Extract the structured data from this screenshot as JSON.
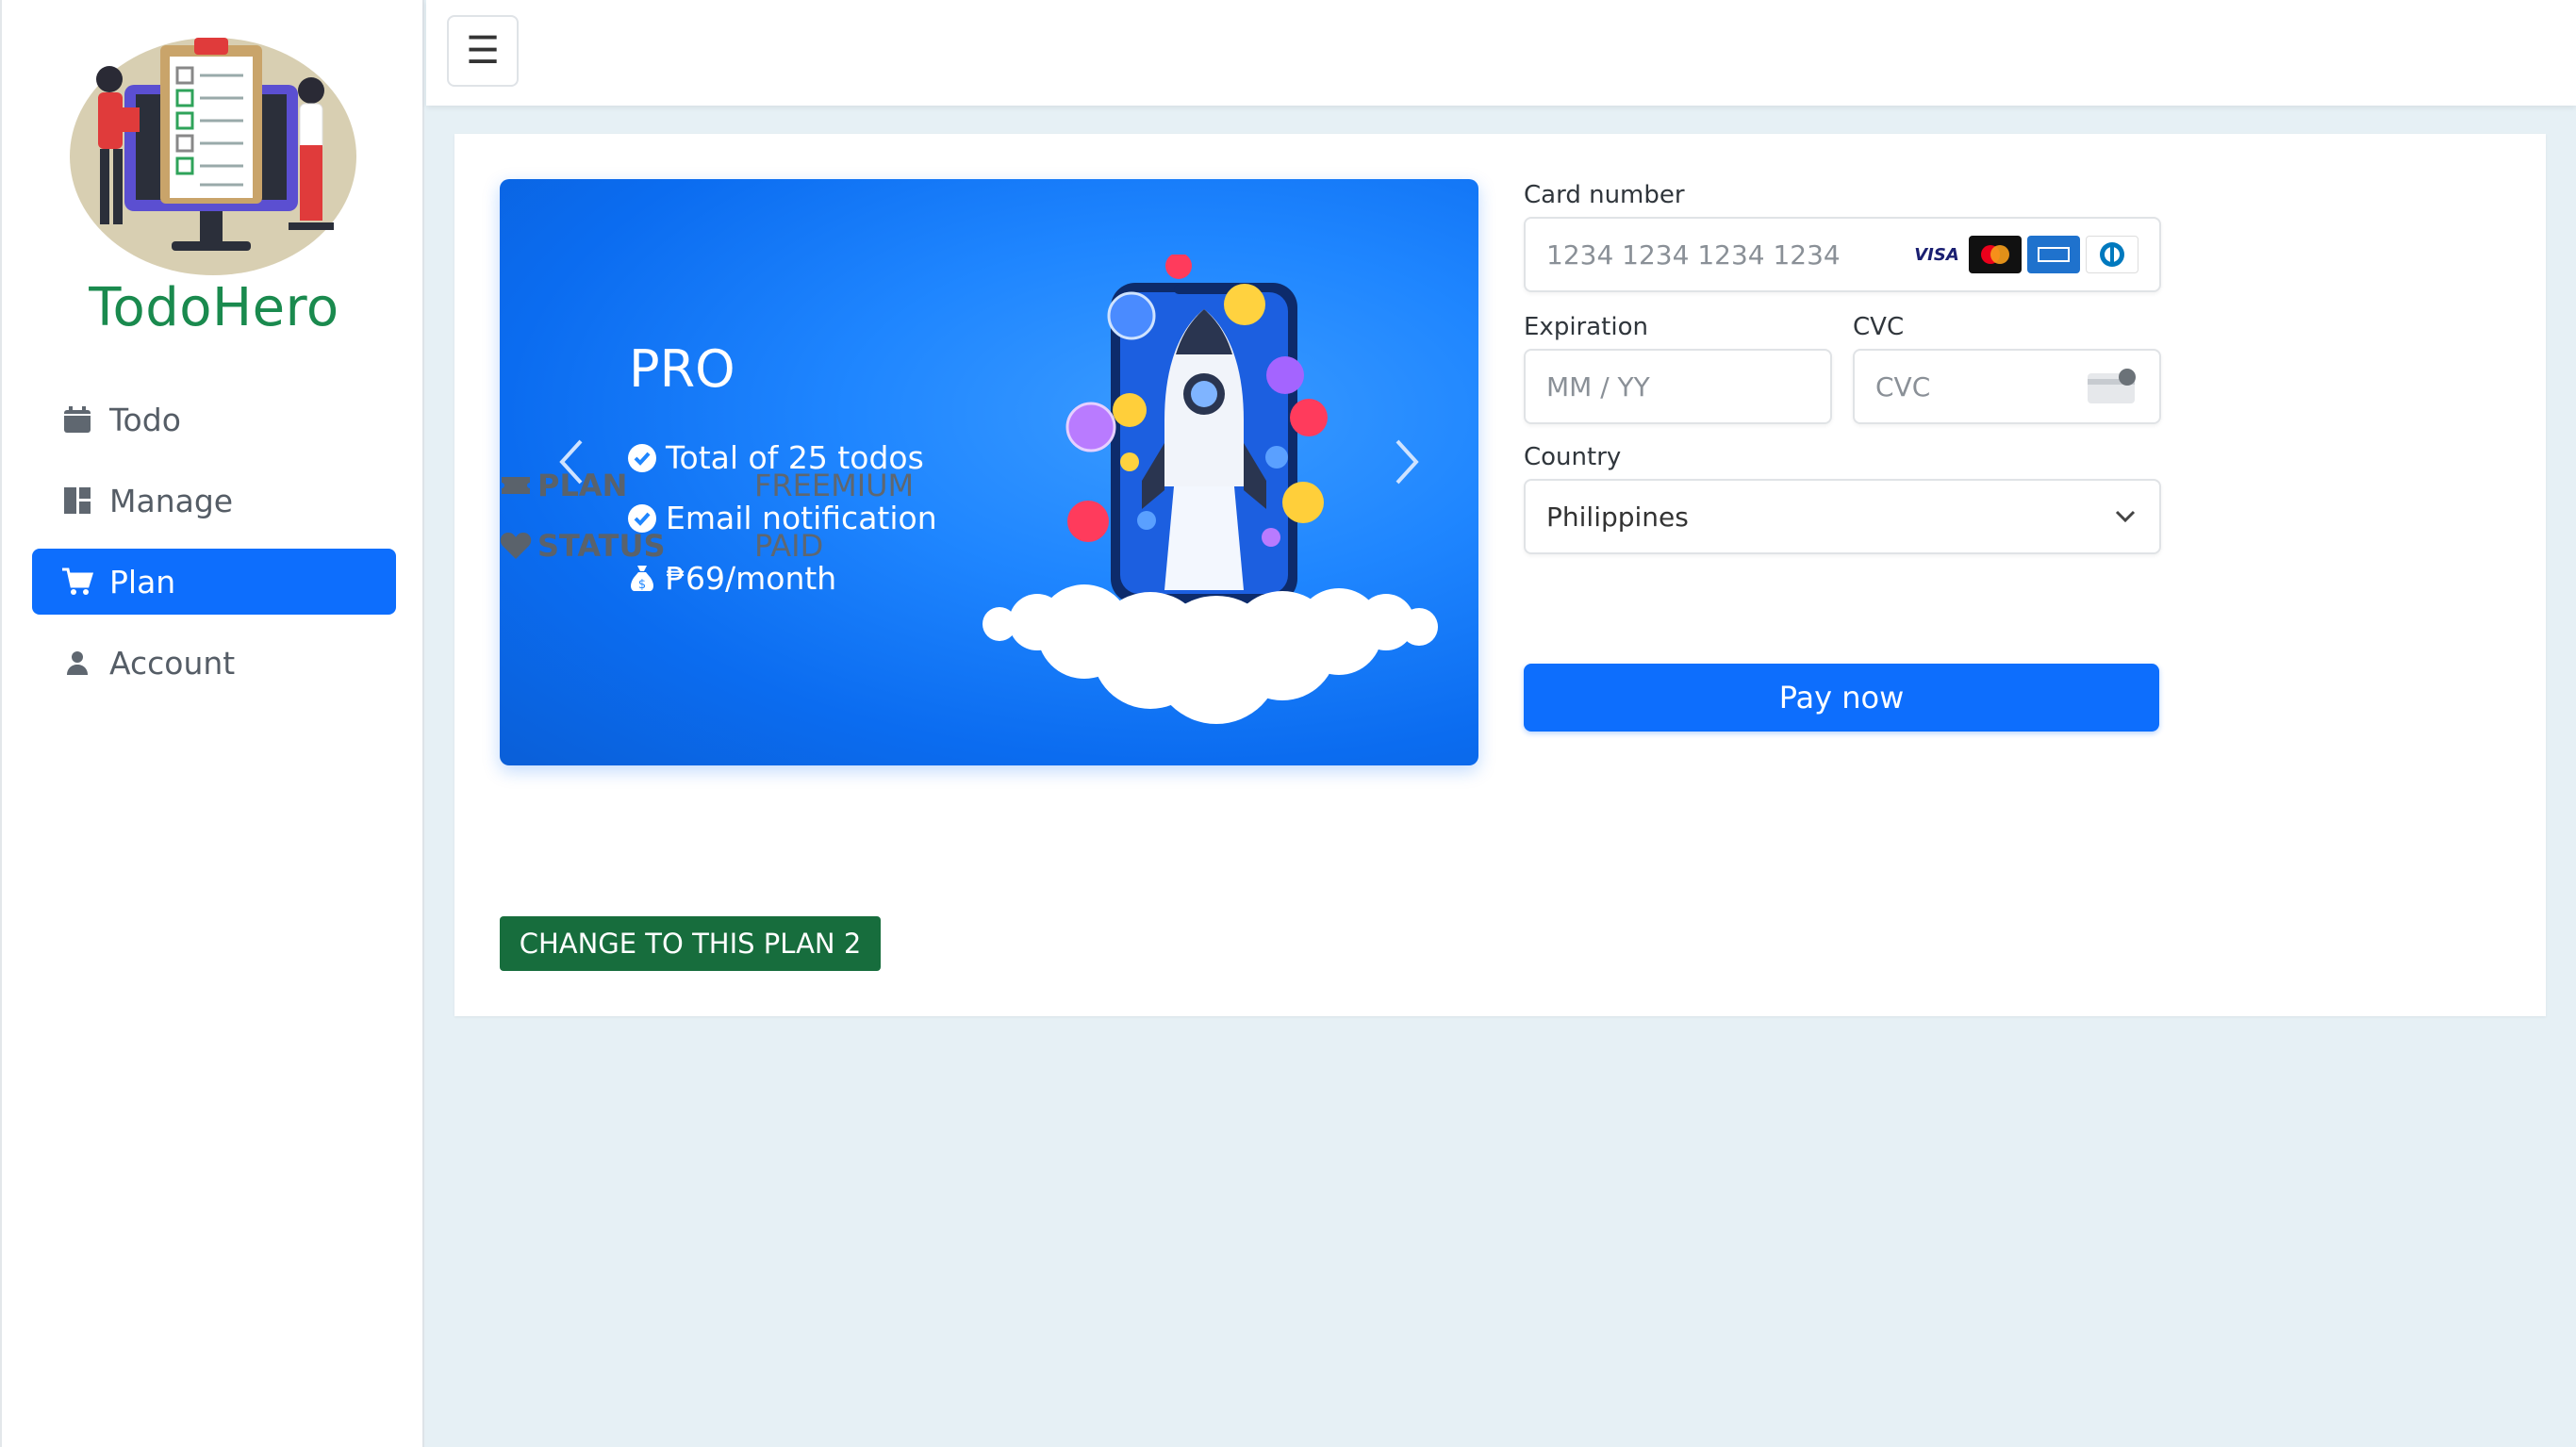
{
  "app": {
    "brand": "TodoHero"
  },
  "sidebar": {
    "items": [
      {
        "label": "Todo",
        "icon": "calendar-icon",
        "active": false
      },
      {
        "label": "Manage",
        "icon": "dashboard-icon",
        "active": false
      },
      {
        "label": "Plan",
        "icon": "cart-icon",
        "active": true
      },
      {
        "label": "Account",
        "icon": "user-icon",
        "active": false
      }
    ]
  },
  "topbar": {
    "menu_icon": "☰"
  },
  "carousel": {
    "plan_name": "PRO",
    "features": [
      {
        "icon": "check-circle-icon",
        "text": "Total of 25 todos"
      },
      {
        "icon": "check-circle-icon",
        "text": "Email notification"
      },
      {
        "icon": "money-bag-icon",
        "text": "₱69/month"
      }
    ]
  },
  "plan_info": {
    "plan_label": "PLAN",
    "plan_value": "FREEMIUM",
    "status_label": "STATUS",
    "status_value": "PAID",
    "change_button": "CHANGE TO THIS PLAN 2"
  },
  "payment": {
    "card_number_label": "Card number",
    "card_number_placeholder": "1234 1234 1234 1234",
    "expiration_label": "Expiration",
    "expiration_placeholder": "MM / YY",
    "cvc_label": "CVC",
    "cvc_placeholder": "CVC",
    "country_label": "Country",
    "country_value": "Philippines",
    "pay_button": "Pay now",
    "card_brands": [
      "VISA"
    ]
  },
  "colors": {
    "primary": "#0d6efd",
    "brand_green": "#1a8a4e",
    "change_button": "#176d3d",
    "bg": "#e6f0f5"
  }
}
